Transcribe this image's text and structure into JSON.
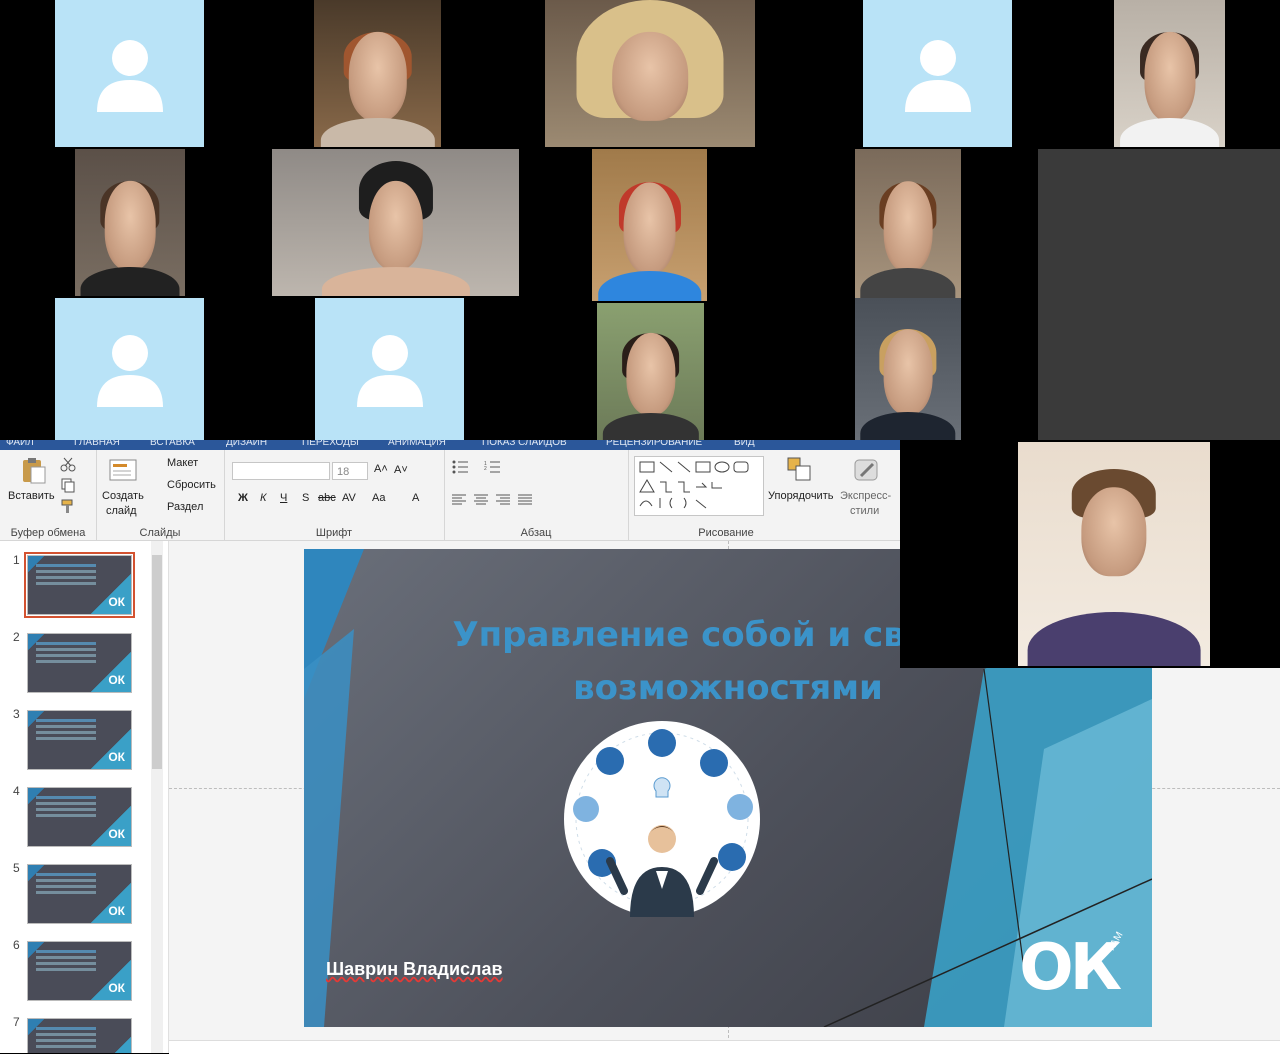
{
  "ribbon_tabs": [
    "ФАЙЛ",
    "ГЛАВНАЯ",
    "ВСТАВКА",
    "ДИЗАЙН",
    "ПЕРЕХОДЫ",
    "АНИМАЦИЯ",
    "ПОКАЗ СЛАЙДОВ",
    "РЕЦЕНЗИРОВАНИЕ",
    "ВИД"
  ],
  "clipboard": {
    "paste_label": "Вставить",
    "group_label": "Буфер обмена"
  },
  "slides_group": {
    "new_slide_line1": "Создать",
    "new_slide_line2": "слайд",
    "layout": "Макет",
    "reset": "Сбросить",
    "section": "Раздел",
    "group_label": "Слайды"
  },
  "font_group": {
    "font_size": "18",
    "bold": "Ж",
    "italic": "К",
    "underline": "Ч",
    "shadow": "S",
    "strike": "abc",
    "spacing": "AV",
    "case": "Aa",
    "group_label": "Шрифт"
  },
  "paragraph_group": {
    "group_label": "Абзац"
  },
  "drawing_group": {
    "arrange": "Упорядочить",
    "styles_line1": "Экспресс-",
    "styles_line2": "стили",
    "group_label": "Рисование"
  },
  "slide": {
    "title": "Управление собой и своими возможностями",
    "author": "Шаврин Владислав",
    "logo": "ОК",
    "logo_small": "ГАМ"
  },
  "thumbnails": [
    "1",
    "2",
    "3",
    "4",
    "5",
    "6",
    "7"
  ],
  "thumb_logo": "ОК",
  "colors": {
    "accent": "#3b93c9",
    "placeholder_bg": "#b9e3f7",
    "ribbon_blue": "#2b579a",
    "selection": "#d35230"
  }
}
